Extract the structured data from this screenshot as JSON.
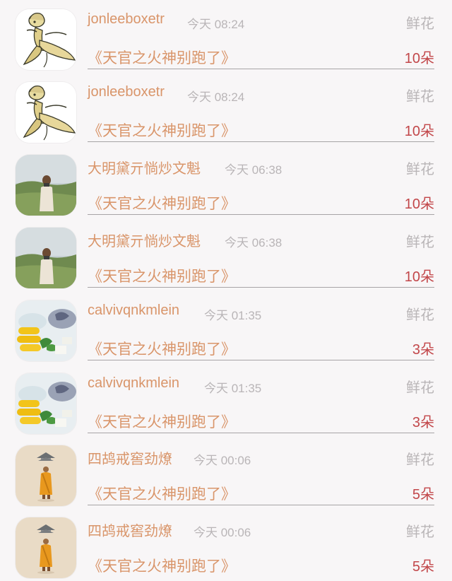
{
  "gift_list": [
    {
      "avatar": "anime-character-avatar",
      "username": "jonleeboxetr",
      "time": "今天 08:24",
      "gift_type": "鲜花",
      "book_title": "《天官之火神别跑了》",
      "count": "10朵"
    },
    {
      "avatar": "anime-character-avatar",
      "username": "jonleeboxetr",
      "time": "今天 08:24",
      "gift_type": "鲜花",
      "book_title": "《天官之火神别跑了》",
      "count": "10朵"
    },
    {
      "avatar": "landscape-photo-avatar",
      "username": "大明黛亓惝炒文魁",
      "time": "今天 06:38",
      "gift_type": "鲜花",
      "book_title": "《天官之火神别跑了》",
      "count": "10朵"
    },
    {
      "avatar": "landscape-photo-avatar",
      "username": "大明黛亓惝炒文魁",
      "time": "今天 06:38",
      "gift_type": "鲜花",
      "book_title": "《天官之火神别跑了》",
      "count": "10朵"
    },
    {
      "avatar": "food-photo-avatar",
      "username": "calvivqnkmlein",
      "time": "今天 01:35",
      "gift_type": "鲜花",
      "book_title": "《天官之火神别跑了》",
      "count": "3朵"
    },
    {
      "avatar": "food-photo-avatar",
      "username": "calvivqnkmlein",
      "time": "今天 01:35",
      "gift_type": "鲜花",
      "book_title": "《天官之火神别跑了》",
      "count": "3朵"
    },
    {
      "avatar": "monk-figure-avatar",
      "username": "四鸪戒窖劲燎",
      "time": "今天 00:06",
      "gift_type": "鲜花",
      "book_title": "《天官之火神别跑了》",
      "count": "5朵"
    },
    {
      "avatar": "monk-figure-avatar",
      "username": "四鸪戒窖劲燎",
      "time": "今天 00:06",
      "gift_type": "鲜花",
      "book_title": "《天官之火神别跑了》",
      "count": "5朵"
    }
  ]
}
